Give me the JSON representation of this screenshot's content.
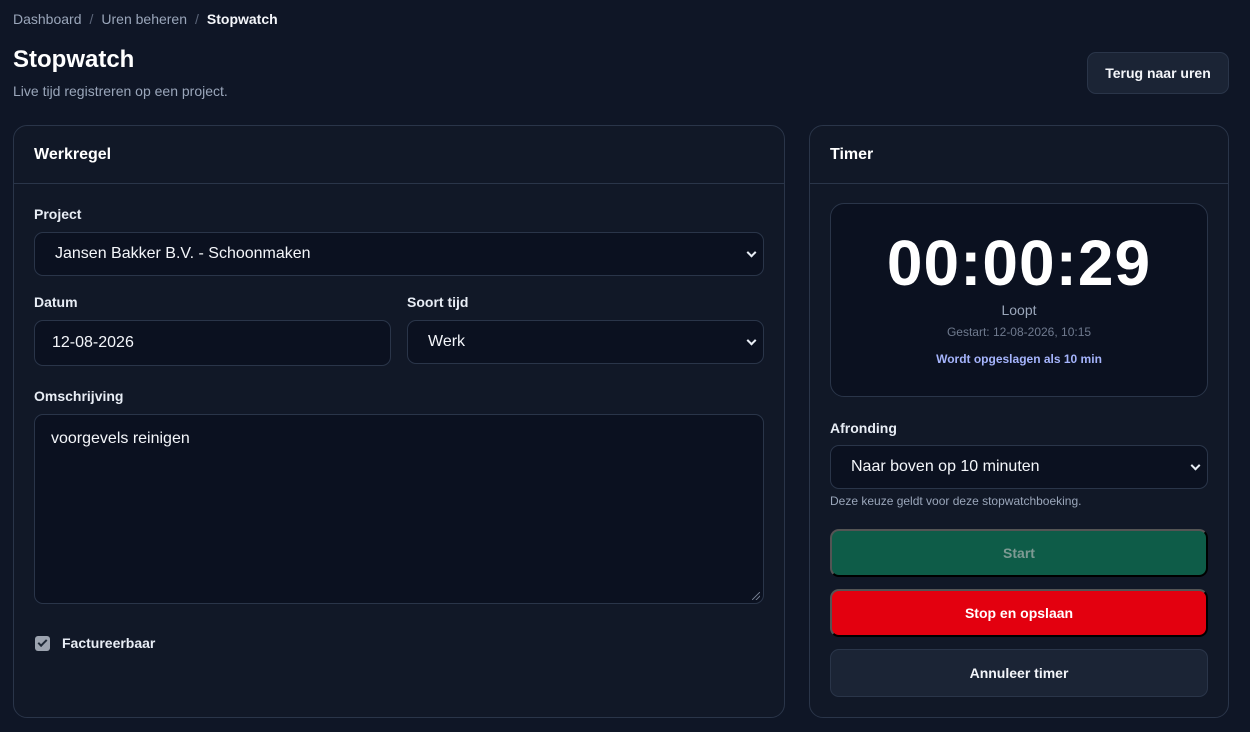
{
  "breadcrumb": {
    "items": [
      "Dashboard",
      "Uren beheren"
    ],
    "separator": "/",
    "current": "Stopwatch"
  },
  "header": {
    "title": "Stopwatch",
    "subtitle": "Live tijd registreren op een project.",
    "back_button": "Terug naar uren"
  },
  "werkregel": {
    "title": "Werkregel",
    "project_label": "Project",
    "project_value": "Jansen Bakker B.V. - Schoonmaken",
    "datum_label": "Datum",
    "datum_value": "12-08-2026",
    "soort_label": "Soort tijd",
    "soort_value": "Werk",
    "omschrijving_label": "Omschrijving",
    "omschrijving_value": "voorgevels reinigen",
    "factureerbaar_label": "Factureerbaar",
    "factureerbaar_checked": true
  },
  "timer": {
    "title": "Timer",
    "display": "00:00:29",
    "status": "Loopt",
    "started": "Gestart: 12-08-2026, 10:15",
    "saved_as": "Wordt opgeslagen als 10 min",
    "afronding_label": "Afronding",
    "afronding_value": "Naar boven op 10 minuten",
    "afronding_hint": "Deze keuze geldt voor deze stopwatchboeking.",
    "start_button": "Start",
    "stop_button": "Stop en opslaan",
    "cancel_button": "Annuleer timer"
  },
  "colors": {
    "background": "#0f1626",
    "card": "#111827",
    "start": "#0e5c48",
    "stop": "#e3000f",
    "accent_text": "#a5b4fc"
  }
}
